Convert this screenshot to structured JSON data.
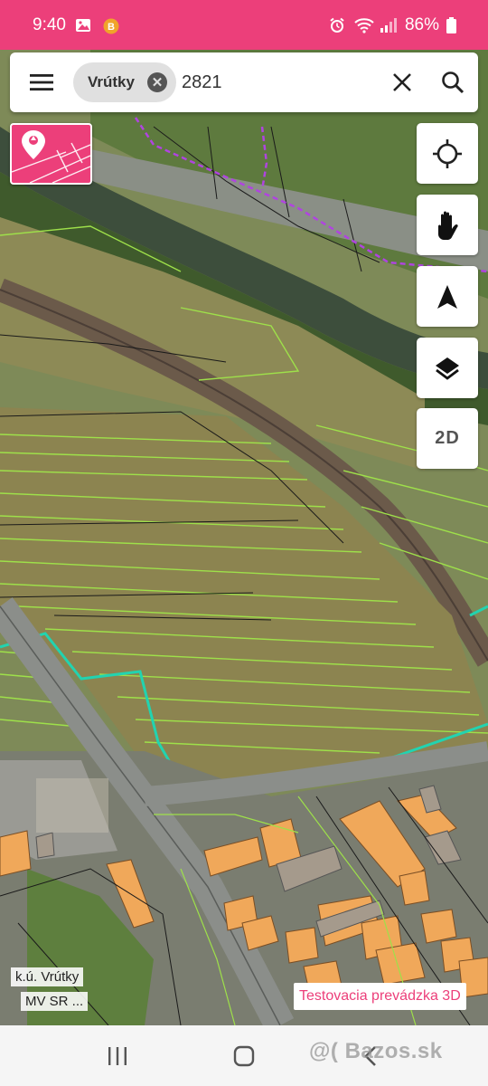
{
  "status_bar": {
    "time": "9:40",
    "battery": "86%",
    "icons": [
      "gallery-icon",
      "app-notification-icon",
      "alarm-icon",
      "wifi-icon",
      "signal-icon",
      "battery-icon"
    ]
  },
  "search": {
    "chip_label": "Vrútky",
    "query": "2821",
    "icons": [
      "menu-icon",
      "chip-remove-icon",
      "clear-icon",
      "search-icon"
    ]
  },
  "controls": {
    "locate_icon": "crosshair-icon",
    "pan_icon": "hand-icon",
    "north_icon": "navigation-arrow-icon",
    "layers_icon": "layers-icon",
    "view_mode_label": "2D"
  },
  "map": {
    "cadastral_label": "k.ú. Vrútky",
    "source_label": "MV SR ...",
    "test_badge": "Testovacia prevádzka 3D",
    "colors": {
      "parcel_lines": "#9ee04a",
      "boundary": "#22d3b0",
      "admin_boundary": "#b044e0",
      "building": "#f0a85a"
    }
  },
  "nav": {
    "icons": [
      "recents-icon",
      "home-icon",
      "back-icon"
    ]
  },
  "watermark": "@( Bazos.sk"
}
